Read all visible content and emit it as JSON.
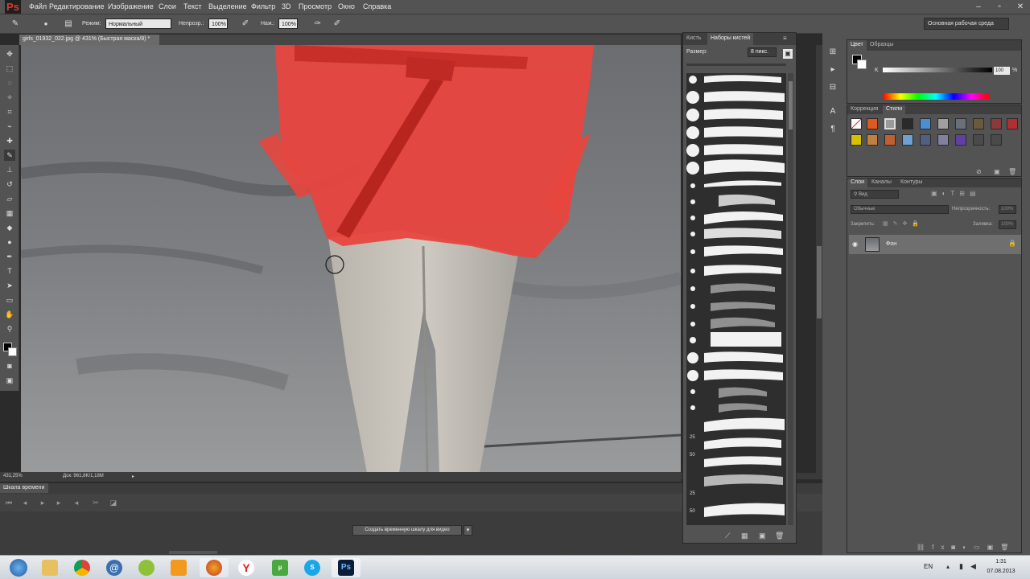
{
  "app": {
    "logo": "Ps"
  },
  "menu": [
    "Файл",
    "Редактирование",
    "Изображение",
    "Слои",
    "Текст",
    "Выделение",
    "Фильтр",
    "3D",
    "Просмотр",
    "Окно",
    "Справка"
  ],
  "options": {
    "mode_label": "Режим:",
    "mode_value": "Нормальный",
    "opacity_label": "Непрозр.:",
    "opacity_value": "100%",
    "pressure_label": "Наж.:",
    "pressure_value": "100%"
  },
  "workspace": {
    "value": "Основная рабочая среда"
  },
  "document": {
    "tab_title": "girls_01932_022.jpg @ 431% (Быстрая маска/8) *",
    "zoom": "431,25%",
    "doc_info": "Док: 961,8K/1,18M"
  },
  "timeline": {
    "tab": "Шкала времени",
    "create_button": "Создать временную шкалу для видео"
  },
  "brush_panel": {
    "tabs": [
      "Кисть",
      "Наборы кистей"
    ],
    "size_label": "Размер:",
    "size_value": "8 пикс.",
    "sizes": [
      "25",
      "50",
      "25",
      "50"
    ]
  },
  "color_panel": {
    "tabs": [
      "Цвет",
      "Образцы"
    ],
    "k_label": "K",
    "k_value": "100",
    "k_unit": "%"
  },
  "styles_panel": {
    "tabs": [
      "Коррекция",
      "Стили"
    ]
  },
  "layers_panel": {
    "tabs": [
      "Слои",
      "Каналы",
      "Контуры"
    ],
    "filter_label": "Вид",
    "blend_mode": "Обычные",
    "opacity_label": "Непрозрачность:",
    "opacity_value": "100%",
    "lock_label": "Закрепить:",
    "fill_label": "Заливка:",
    "fill_value": "100%",
    "layer_name": "Фон"
  },
  "taskbar": {
    "lang": "EN",
    "time": "1:31",
    "date": "07.08.2013",
    "ps_label": "Ps"
  },
  "colors": {
    "mask_red": "#e8463e",
    "panel_bg": "#535353",
    "dark_bg": "#3c3c3c"
  }
}
